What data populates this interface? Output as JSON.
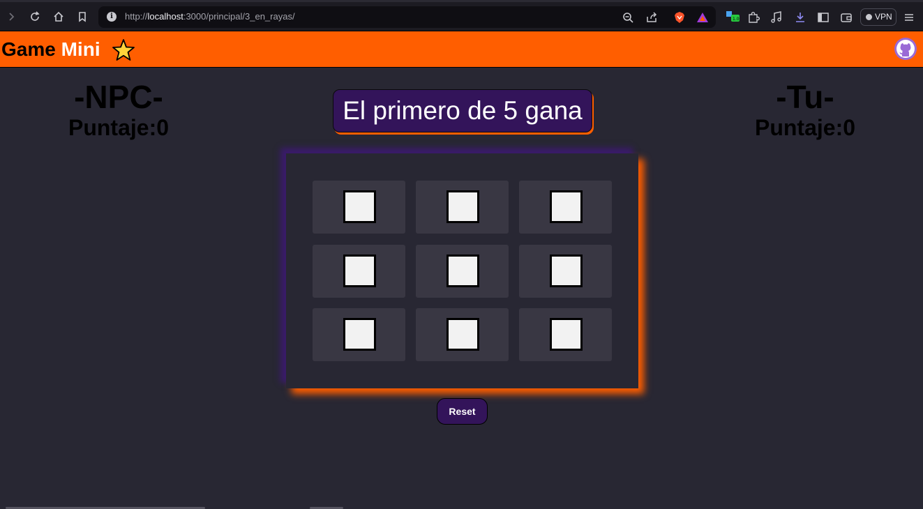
{
  "browser": {
    "url_prefix": "http://",
    "url_host": "localhost",
    "url_rest": ":3000/principal/3_en_rayas/",
    "vpn_label": "VPN"
  },
  "header": {
    "brand_game": "Game ",
    "brand_mini": "Mini",
    "accent_color": "#ff5e00"
  },
  "npc": {
    "name": "-NPC-",
    "score_label": "Puntaje:0"
  },
  "player": {
    "name": "-Tu-",
    "score_label": "Puntaje:0"
  },
  "banner": {
    "text": "El primero de 5 gana"
  },
  "board": {
    "cells": [
      "",
      "",
      "",
      "",
      "",
      "",
      "",
      "",
      ""
    ]
  },
  "reset": {
    "label": "Reset"
  }
}
